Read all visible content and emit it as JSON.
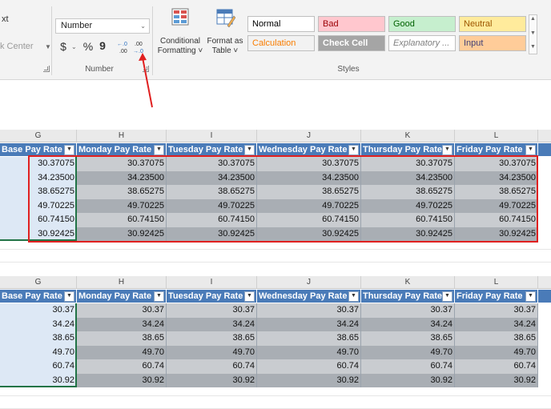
{
  "ribbon": {
    "left": {
      "text_label": "xt",
      "merge_label": "k Center"
    },
    "number": {
      "format_value": "Number",
      "currency_label": "$",
      "percent_label": "%",
      "comma_label": "9",
      "increase_decimal_label": "←.0 .00",
      "decrease_decimal_label": ".00 →.0",
      "group_label": "Number"
    },
    "conditional_formatting": {
      "line1": "Conditional",
      "line2": "Formatting ˅"
    },
    "format_as_table": {
      "line1": "Format as",
      "line2": "Table ˅"
    },
    "styles": {
      "group_label": "Styles",
      "cells": [
        {
          "label": "Normal",
          "bg": "#ffffff",
          "fg": "#000000"
        },
        {
          "label": "Bad",
          "bg": "#ffc7ce",
          "fg": "#9c0006"
        },
        {
          "label": "Good",
          "bg": "#c6efce",
          "fg": "#006100"
        },
        {
          "label": "Neutral",
          "bg": "#ffeb9c",
          "fg": "#9c5700"
        },
        {
          "label": "Calculation",
          "bg": "#f2f2f2",
          "fg": "#fa7d00"
        },
        {
          "label": "Check Cell",
          "bg": "#a5a5a5",
          "fg": "#ffffff"
        },
        {
          "label": "Explanatory ...",
          "bg": "#ffffff",
          "fg": "#7f7f7f"
        },
        {
          "label": "Input",
          "bg": "#ffcc99",
          "fg": "#3f3f76"
        }
      ]
    }
  },
  "columns": [
    "G",
    "H",
    "I",
    "J",
    "K",
    "L"
  ],
  "headers": [
    "Base Pay Rate",
    "Monday Pay Rate",
    "Tuesday Pay Rate",
    "Wednesday Pay Rate",
    "Thursday Pay Rate",
    "Friday Pay Rate"
  ],
  "table_top": {
    "rows": [
      [
        "30.37075",
        "30.37075",
        "30.37075",
        "30.37075",
        "30.37075",
        "30.37075"
      ],
      [
        "34.23500",
        "34.23500",
        "34.23500",
        "34.23500",
        "34.23500",
        "34.23500"
      ],
      [
        "38.65275",
        "38.65275",
        "38.65275",
        "38.65275",
        "38.65275",
        "38.65275"
      ],
      [
        "49.70225",
        "49.70225",
        "49.70225",
        "49.70225",
        "49.70225",
        "49.70225"
      ],
      [
        "60.74150",
        "60.74150",
        "60.74150",
        "60.74150",
        "60.74150",
        "60.74150"
      ],
      [
        "30.92425",
        "30.92425",
        "30.92425",
        "30.92425",
        "30.92425",
        "30.92425"
      ]
    ]
  },
  "table_bottom": {
    "rows": [
      [
        "30.37",
        "30.37",
        "30.37",
        "30.37",
        "30.37",
        "30.37"
      ],
      [
        "34.24",
        "34.24",
        "34.24",
        "34.24",
        "34.24",
        "34.24"
      ],
      [
        "38.65",
        "38.65",
        "38.65",
        "38.65",
        "38.65",
        "38.65"
      ],
      [
        "49.70",
        "49.70",
        "49.70",
        "49.70",
        "49.70",
        "49.70"
      ],
      [
        "60.74",
        "60.74",
        "60.74",
        "60.74",
        "60.74",
        "60.74"
      ],
      [
        "30.92",
        "30.92",
        "30.92",
        "30.92",
        "30.92",
        "30.92"
      ]
    ]
  },
  "colors": {
    "table_header": "#4a7bb8",
    "band_light": "#c9ccd0",
    "band_dark": "#a9aeb4",
    "highlight": "#e02020"
  },
  "icons": {
    "dialog_launcher": "dialog-launcher-icon",
    "conditional_formatting": "conditional-formatting-icon",
    "format_as_table": "format-as-table-icon",
    "filter": "filter-dropdown-icon"
  }
}
